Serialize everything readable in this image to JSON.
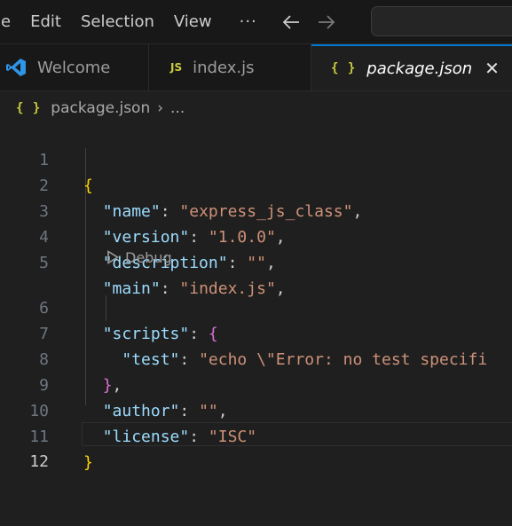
{
  "menubar": {
    "items": [
      "le",
      "Edit",
      "Selection",
      "View"
    ],
    "more": "···",
    "back_icon": "arrow-left-icon",
    "forward_icon": "arrow-right-icon"
  },
  "tabs": [
    {
      "label": "Welcome",
      "icon": "vscode-logo-icon",
      "active": false
    },
    {
      "label": "index.js",
      "icon": "js-file-icon",
      "icon_text": "JS",
      "active": false
    },
    {
      "label": "package.json",
      "icon": "json-file-icon",
      "icon_text": "{ }",
      "active": true,
      "close": "✕"
    }
  ],
  "breadcrumb": {
    "icon_text": "{ }",
    "file": "package.json",
    "separator": "›",
    "tail": "..."
  },
  "editor": {
    "current_line": 12,
    "lines": [
      {
        "n": "1"
      },
      {
        "n": "2",
        "key": "\"name\"",
        "value": "\"express_js_class\""
      },
      {
        "n": "3",
        "key": "\"version\"",
        "value": "\"1.0.0\""
      },
      {
        "n": "4",
        "key": "\"description\"",
        "value": "\"\""
      },
      {
        "n": "5",
        "key": "\"main\"",
        "value": "\"index.js\""
      },
      {
        "n": "6",
        "key": "\"scripts\""
      },
      {
        "n": "7",
        "key": "\"test\"",
        "value": "\"echo \\\"Error: no test specifi"
      },
      {
        "n": "8"
      },
      {
        "n": "9",
        "key": "\"author\"",
        "value": "\"\""
      },
      {
        "n": "10",
        "key": "\"license\"",
        "value": "\"ISC\""
      },
      {
        "n": "11"
      },
      {
        "n": "12"
      }
    ],
    "codelens": {
      "label": "Debug",
      "icon": "play-outline-icon"
    }
  },
  "colors": {
    "accent": "#0078d4",
    "json_key": "#9cdcfe",
    "json_string": "#ce9178",
    "bracket_level1": "#ffd700",
    "bracket_level2": "#da70d6"
  }
}
